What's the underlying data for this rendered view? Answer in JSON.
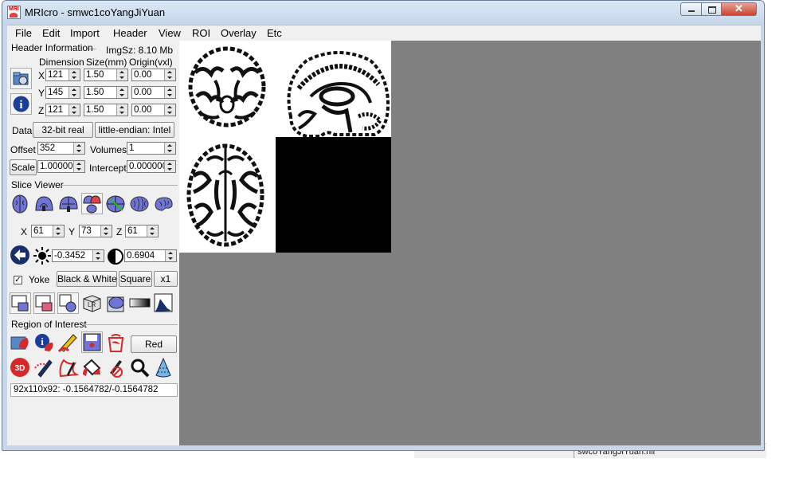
{
  "window": {
    "title": "MRIcro - smwc1coYangJiYuan",
    "app_icon_text": "MRI",
    "close_glyph": "✕"
  },
  "menu": [
    "File",
    "Edit",
    "Import",
    "Header",
    "View",
    "ROI",
    "Overlay",
    "Etc"
  ],
  "header_info": {
    "group_label": "Header Information",
    "img_size": "ImgSz: 8.10 Mb",
    "col_dimension": "Dimension",
    "col_size": "Size(mm)",
    "col_origin": "Origin(vxl)",
    "rows": [
      {
        "axis": "X",
        "dimension": "121",
        "size": "1.50",
        "origin": "0.00"
      },
      {
        "axis": "Y",
        "dimension": "145",
        "size": "1.50",
        "origin": "0.00"
      },
      {
        "axis": "Z",
        "dimension": "121",
        "size": "1.50",
        "origin": "0.00"
      }
    ],
    "data_label": "Data",
    "data_type": "32-bit real",
    "endian": "little-endian: Intel",
    "offset_label": "Offset",
    "offset": "352",
    "volumes_label": "Volumes",
    "volumes": "1",
    "scale_label": "Scale",
    "scale": "1.000000",
    "intercept_label": "Intercept",
    "intercept": "0.000000"
  },
  "slice_viewer": {
    "group_label": "Slice Viewer",
    "x_label": "X",
    "x": "61",
    "y_label": "Y",
    "y": "73",
    "z_label": "Z",
    "z": "61",
    "brightness": "-0.3452",
    "contrast": "0.6904",
    "yoke_label": "Yoke",
    "yoke_check": "✓",
    "colormap": "Black & White",
    "aspect": "Square",
    "zoom": "x1"
  },
  "roi": {
    "group_label": "Region of Interest",
    "color": "Red",
    "three_d": "3D"
  },
  "status": "92x110x92: -0.1564782/-0.1564782",
  "desktop_file": "swcoYangJiYuan.nii",
  "colors": {
    "view_bg": "#808080",
    "panel_bg": "#f0f0f0",
    "icon_blue": "#6f74d6",
    "roi_red": "#d42a2a"
  }
}
